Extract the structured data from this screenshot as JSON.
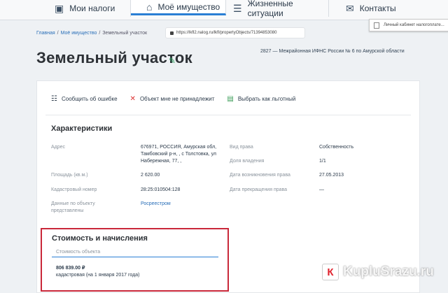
{
  "nav": {
    "tabs": [
      {
        "label": "Мои налоги",
        "icon": "money-icon"
      },
      {
        "label": "Моё имущество",
        "icon": "property-icon"
      },
      {
        "label": "Жизненные ситуации",
        "icon": "list-icon"
      },
      {
        "label": "Контакты",
        "icon": "envelope-icon"
      }
    ]
  },
  "tooltip": {
    "text": "Личный кабинет налогоплате..."
  },
  "breadcrumb": {
    "home": "Главная",
    "sep1": "/",
    "property": "Моё имущество",
    "sep2": "/",
    "current": "Земельный участок"
  },
  "url": {
    "text": "https://lkfl2.nalog.ru/lkfl/propertyObjects/71394853080"
  },
  "page": {
    "title": "Земельный участок",
    "inspection": "2827 — Межрайонная ИФНС России № 6 по Амурской области"
  },
  "actions": [
    {
      "label": "Сообщить об ошибке",
      "icon": "list-report-icon"
    },
    {
      "label": "Объект мне не принадлежит",
      "icon": "cross-icon"
    },
    {
      "label": "Выбрать как льготный",
      "icon": "document-check-icon"
    }
  ],
  "characteristics": {
    "title": "Характеристики",
    "address_label": "Адрес",
    "address_value": "676971, РОССИЯ, Амурская обл, Тамбовский р-н, , с Толстовка, ул Набережная, 77, ,",
    "area_label": "Площадь (кв.м.)",
    "area_value": "2 620.00",
    "cadastral_label": "Кадастровый номер",
    "cadastral_value": "28:25:010504:128",
    "source_label": "Данные по объекту представлены",
    "source_value": "Росреестром",
    "right_label": "Вид права",
    "right_value": "Собственность",
    "share_label": "Доля владения",
    "share_value": "1/1",
    "start_label": "Дата возникновения права",
    "start_value": "27.05.2013",
    "end_label": "Дата прекращения права",
    "end_value": "—"
  },
  "cost": {
    "title": "Стоимость и начисления",
    "input_placeholder": "Стоимость объекта",
    "value": "806 839.00 ₽",
    "note": "кадастровая (на 1 января 2017 года)"
  },
  "watermark": {
    "text": "KupluSrazu.ru",
    "icon_symbol": "К"
  }
}
